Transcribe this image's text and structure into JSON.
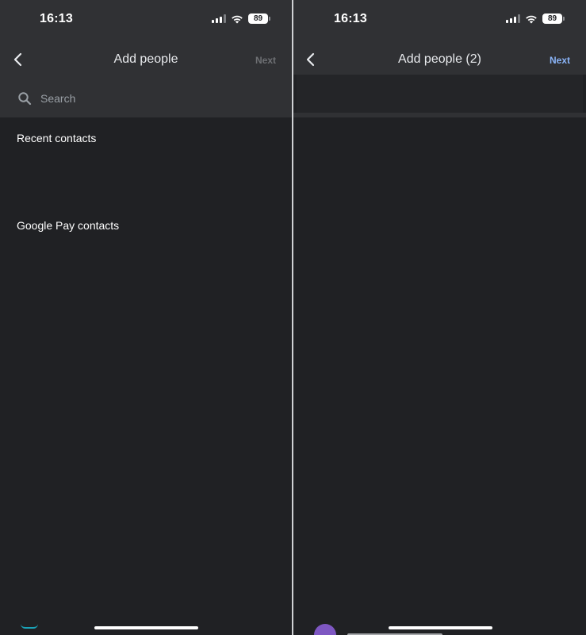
{
  "left": {
    "status": {
      "time": "16:13",
      "battery": "89"
    },
    "nav": {
      "title": "Add people",
      "next_label": "Next"
    },
    "search": {
      "placeholder": "Search"
    },
    "sections": {
      "recent": "Recent contacts",
      "gpay": "Google Pay contacts"
    }
  },
  "right": {
    "status": {
      "time": "16:13",
      "battery": "89"
    },
    "nav": {
      "title": "Add people (2)",
      "next_label": "Next"
    }
  },
  "colors": {
    "background": "#202124",
    "header": "#303134",
    "next_enabled": "#8ab4f8",
    "next_disabled": "#6e7074",
    "avatar": "#7e57c2"
  }
}
